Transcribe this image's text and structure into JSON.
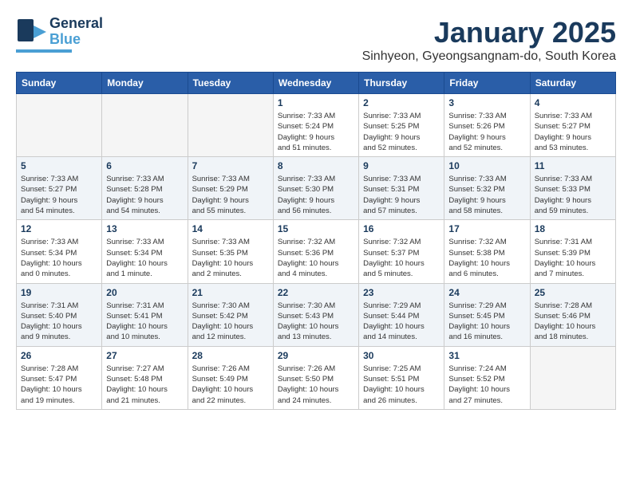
{
  "logo": {
    "line1": "General",
    "line2": "Blue"
  },
  "title": "January 2025",
  "subtitle": "Sinhyeon, Gyeongsangnam-do, South Korea",
  "weekdays": [
    "Sunday",
    "Monday",
    "Tuesday",
    "Wednesday",
    "Thursday",
    "Friday",
    "Saturday"
  ],
  "weeks": [
    [
      {
        "day": "",
        "info": ""
      },
      {
        "day": "",
        "info": ""
      },
      {
        "day": "",
        "info": ""
      },
      {
        "day": "1",
        "info": "Sunrise: 7:33 AM\nSunset: 5:24 PM\nDaylight: 9 hours\nand 51 minutes."
      },
      {
        "day": "2",
        "info": "Sunrise: 7:33 AM\nSunset: 5:25 PM\nDaylight: 9 hours\nand 52 minutes."
      },
      {
        "day": "3",
        "info": "Sunrise: 7:33 AM\nSunset: 5:26 PM\nDaylight: 9 hours\nand 52 minutes."
      },
      {
        "day": "4",
        "info": "Sunrise: 7:33 AM\nSunset: 5:27 PM\nDaylight: 9 hours\nand 53 minutes."
      }
    ],
    [
      {
        "day": "5",
        "info": "Sunrise: 7:33 AM\nSunset: 5:27 PM\nDaylight: 9 hours\nand 54 minutes."
      },
      {
        "day": "6",
        "info": "Sunrise: 7:33 AM\nSunset: 5:28 PM\nDaylight: 9 hours\nand 54 minutes."
      },
      {
        "day": "7",
        "info": "Sunrise: 7:33 AM\nSunset: 5:29 PM\nDaylight: 9 hours\nand 55 minutes."
      },
      {
        "day": "8",
        "info": "Sunrise: 7:33 AM\nSunset: 5:30 PM\nDaylight: 9 hours\nand 56 minutes."
      },
      {
        "day": "9",
        "info": "Sunrise: 7:33 AM\nSunset: 5:31 PM\nDaylight: 9 hours\nand 57 minutes."
      },
      {
        "day": "10",
        "info": "Sunrise: 7:33 AM\nSunset: 5:32 PM\nDaylight: 9 hours\nand 58 minutes."
      },
      {
        "day": "11",
        "info": "Sunrise: 7:33 AM\nSunset: 5:33 PM\nDaylight: 9 hours\nand 59 minutes."
      }
    ],
    [
      {
        "day": "12",
        "info": "Sunrise: 7:33 AM\nSunset: 5:34 PM\nDaylight: 10 hours\nand 0 minutes."
      },
      {
        "day": "13",
        "info": "Sunrise: 7:33 AM\nSunset: 5:34 PM\nDaylight: 10 hours\nand 1 minute."
      },
      {
        "day": "14",
        "info": "Sunrise: 7:33 AM\nSunset: 5:35 PM\nDaylight: 10 hours\nand 2 minutes."
      },
      {
        "day": "15",
        "info": "Sunrise: 7:32 AM\nSunset: 5:36 PM\nDaylight: 10 hours\nand 4 minutes."
      },
      {
        "day": "16",
        "info": "Sunrise: 7:32 AM\nSunset: 5:37 PM\nDaylight: 10 hours\nand 5 minutes."
      },
      {
        "day": "17",
        "info": "Sunrise: 7:32 AM\nSunset: 5:38 PM\nDaylight: 10 hours\nand 6 minutes."
      },
      {
        "day": "18",
        "info": "Sunrise: 7:31 AM\nSunset: 5:39 PM\nDaylight: 10 hours\nand 7 minutes."
      }
    ],
    [
      {
        "day": "19",
        "info": "Sunrise: 7:31 AM\nSunset: 5:40 PM\nDaylight: 10 hours\nand 9 minutes."
      },
      {
        "day": "20",
        "info": "Sunrise: 7:31 AM\nSunset: 5:41 PM\nDaylight: 10 hours\nand 10 minutes."
      },
      {
        "day": "21",
        "info": "Sunrise: 7:30 AM\nSunset: 5:42 PM\nDaylight: 10 hours\nand 12 minutes."
      },
      {
        "day": "22",
        "info": "Sunrise: 7:30 AM\nSunset: 5:43 PM\nDaylight: 10 hours\nand 13 minutes."
      },
      {
        "day": "23",
        "info": "Sunrise: 7:29 AM\nSunset: 5:44 PM\nDaylight: 10 hours\nand 14 minutes."
      },
      {
        "day": "24",
        "info": "Sunrise: 7:29 AM\nSunset: 5:45 PM\nDaylight: 10 hours\nand 16 minutes."
      },
      {
        "day": "25",
        "info": "Sunrise: 7:28 AM\nSunset: 5:46 PM\nDaylight: 10 hours\nand 18 minutes."
      }
    ],
    [
      {
        "day": "26",
        "info": "Sunrise: 7:28 AM\nSunset: 5:47 PM\nDaylight: 10 hours\nand 19 minutes."
      },
      {
        "day": "27",
        "info": "Sunrise: 7:27 AM\nSunset: 5:48 PM\nDaylight: 10 hours\nand 21 minutes."
      },
      {
        "day": "28",
        "info": "Sunrise: 7:26 AM\nSunset: 5:49 PM\nDaylight: 10 hours\nand 22 minutes."
      },
      {
        "day": "29",
        "info": "Sunrise: 7:26 AM\nSunset: 5:50 PM\nDaylight: 10 hours\nand 24 minutes."
      },
      {
        "day": "30",
        "info": "Sunrise: 7:25 AM\nSunset: 5:51 PM\nDaylight: 10 hours\nand 26 minutes."
      },
      {
        "day": "31",
        "info": "Sunrise: 7:24 AM\nSunset: 5:52 PM\nDaylight: 10 hours\nand 27 minutes."
      },
      {
        "day": "",
        "info": ""
      }
    ]
  ]
}
